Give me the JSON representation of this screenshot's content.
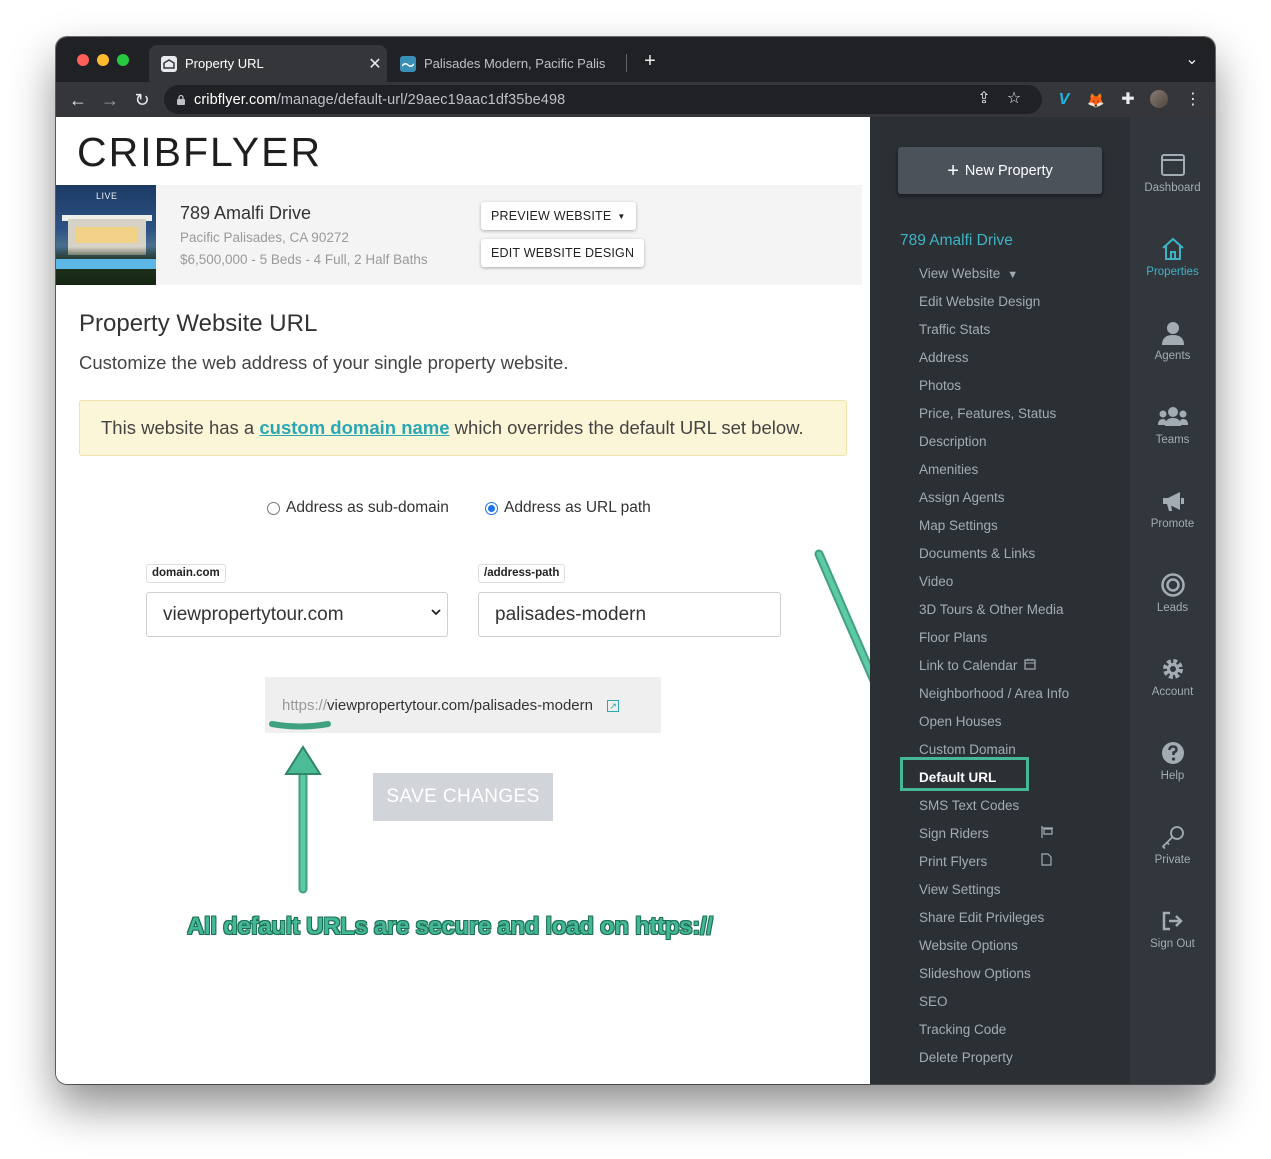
{
  "browser": {
    "tabs": [
      {
        "title": "Property URL",
        "active": true
      },
      {
        "title": "Palisades Modern, Pacific Palis",
        "active": false
      }
    ],
    "close_glyph": "✕",
    "new_tab_glyph": "+",
    "tab_menu_glyph": "⌄",
    "url_host": "cribflyer.com",
    "url_path": "/manage/default-url/29aec19aac1df35be498",
    "nav": {
      "back": "←",
      "forward": "→",
      "reload": "↻"
    },
    "toolbar_icons": {
      "share": "⇪",
      "star": "☆",
      "vimeo": "V",
      "fox": "🦊",
      "puzzle": "✚",
      "menu": "⋮"
    },
    "colors": {
      "close": "#ff5f57",
      "minimize": "#febc2e",
      "zoom": "#28c840"
    }
  },
  "logo": "CRIBFLYER",
  "property": {
    "live_badge": "LIVE",
    "address": "789 Amalfi Drive",
    "city": "Pacific Palisades, CA 90272",
    "details": "$6,500,000 - 5 Beds - 4 Full, 2 Half Baths",
    "preview_button": "PREVIEW WEBSITE",
    "edit_button": "EDIT WEBSITE DESIGN"
  },
  "page": {
    "title": "Property Website URL",
    "subtitle": "Customize the web address of your single property website.",
    "alert_before": "This website has a ",
    "alert_link": "custom domain name",
    "alert_after": " which overrides the default URL set below.",
    "radio_subdomain": "Address as sub-domain",
    "radio_path": "Address as URL path",
    "radio_selected": "path",
    "domain_label": "domain.com",
    "domain_value": "viewpropertytour.com",
    "path_label": "/address-path",
    "path_value": "palisades-modern",
    "url_protocol": "https://",
    "url_rest": "viewpropertytour.com/palisades-modern",
    "save_button": "SAVE CHANGES"
  },
  "annotation": {
    "text": "All default URLs are secure and load on https://",
    "color": "#44b797"
  },
  "sidebar": {
    "new_property": "New Property",
    "property_heading": "789 Amalfi Drive",
    "items": [
      "View Website",
      "Edit Website Design",
      "Traffic Stats",
      "Address",
      "Photos",
      "Price, Features, Status",
      "Description",
      "Amenities",
      "Assign Agents",
      "Map Settings",
      "Documents & Links",
      "Video",
      "3D Tours & Other Media",
      "Floor Plans",
      "Link to Calendar",
      "Neighborhood / Area Info",
      "Open Houses",
      "Custom Domain",
      "Default URL",
      "SMS Text Codes",
      "Sign Riders",
      "Print Flyers",
      "View Settings",
      "Share Edit Privileges",
      "Website Options",
      "Slideshow Options",
      "SEO",
      "Tracking Code",
      "Delete Property"
    ],
    "active_item": "Default URL",
    "accent": "#3fb3c4"
  },
  "rail": [
    {
      "label": "Dashboard",
      "icon": "dashboard-icon"
    },
    {
      "label": "Properties",
      "icon": "home-icon",
      "active": true
    },
    {
      "label": "Agents",
      "icon": "user-icon"
    },
    {
      "label": "Teams",
      "icon": "users-icon"
    },
    {
      "label": "Promote",
      "icon": "megaphone-icon"
    },
    {
      "label": "Leads",
      "icon": "target-icon"
    },
    {
      "label": "Account",
      "icon": "gear-icon"
    },
    {
      "label": "Help",
      "icon": "question-icon"
    },
    {
      "label": "Private",
      "icon": "key-icon"
    },
    {
      "label": "Sign Out",
      "icon": "sign-out-icon"
    }
  ]
}
